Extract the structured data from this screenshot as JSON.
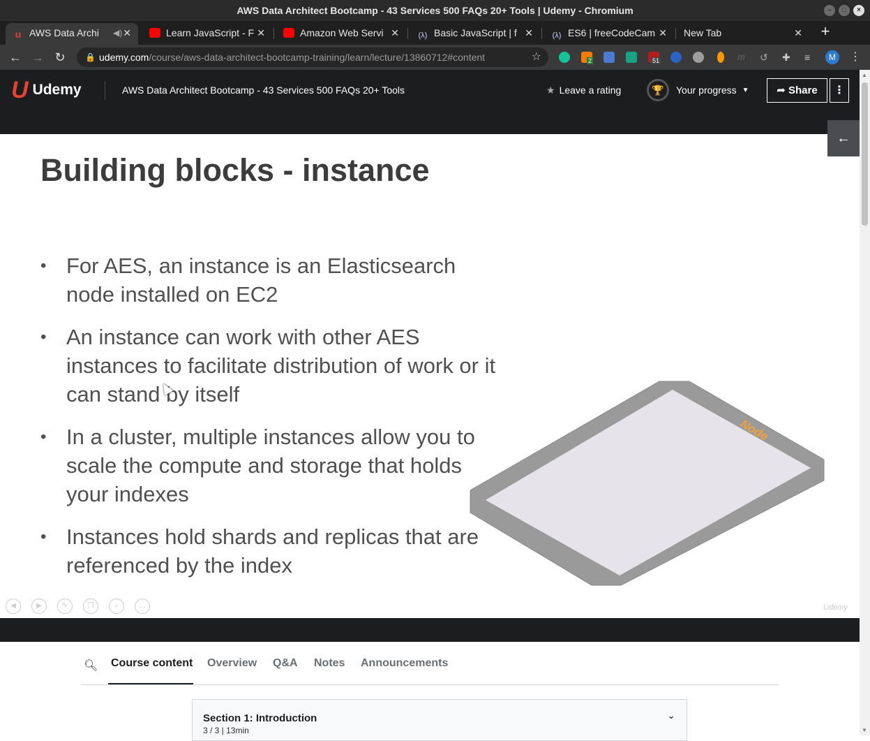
{
  "window": {
    "title": "AWS Data Architect Bootcamp - 43 Services 500 FAQs 20+ Tools | Udemy - Chromium"
  },
  "tabs": [
    {
      "label": "AWS Data Archi",
      "icon": "udemy-icon"
    },
    {
      "label": "Learn JavaScript - F",
      "icon": "youtube-icon"
    },
    {
      "label": "Amazon Web Servi",
      "icon": "youtube-icon"
    },
    {
      "label": "Basic JavaScript | f",
      "icon": "freecodecamp-icon"
    },
    {
      "label": "ES6 | freeCodeCam",
      "icon": "freecodecamp-icon"
    },
    {
      "label": "New Tab",
      "icon": ""
    }
  ],
  "address": {
    "host": "udemy.com",
    "path": "/course/aws-data-architect-bootcamp-training/learn/lecture/13860712#content"
  },
  "extensions": {
    "badge_2": "2",
    "badge_51": "51",
    "profile_initial": "M"
  },
  "header": {
    "logo_text": "Udemy",
    "course_title": "AWS Data Architect Bootcamp - 43 Services 500 FAQs 20+ Tools",
    "rate_label": "Leave a rating",
    "progress_label": "Your progress",
    "share_label": "Share"
  },
  "slide": {
    "title": "Building blocks - instance",
    "bullets": [
      "For AES, an instance is an Elasticsearch node installed on EC2",
      "An instance can work with other AES instances to facilitate distribution of work or it can stand by itself",
      "In a cluster, multiple instances allow you to scale the compute and storage that holds your indexes",
      "Instances hold shards and replicas that are referenced by the index"
    ],
    "node_label": "Node",
    "watermark": "Udemy"
  },
  "content_tabs": {
    "items": [
      "Course content",
      "Overview",
      "Q&A",
      "Notes",
      "Announcements"
    ],
    "active": "Course content"
  },
  "section": {
    "title": "Section 1: Introduction",
    "meta": "3 / 3 | 13min"
  }
}
